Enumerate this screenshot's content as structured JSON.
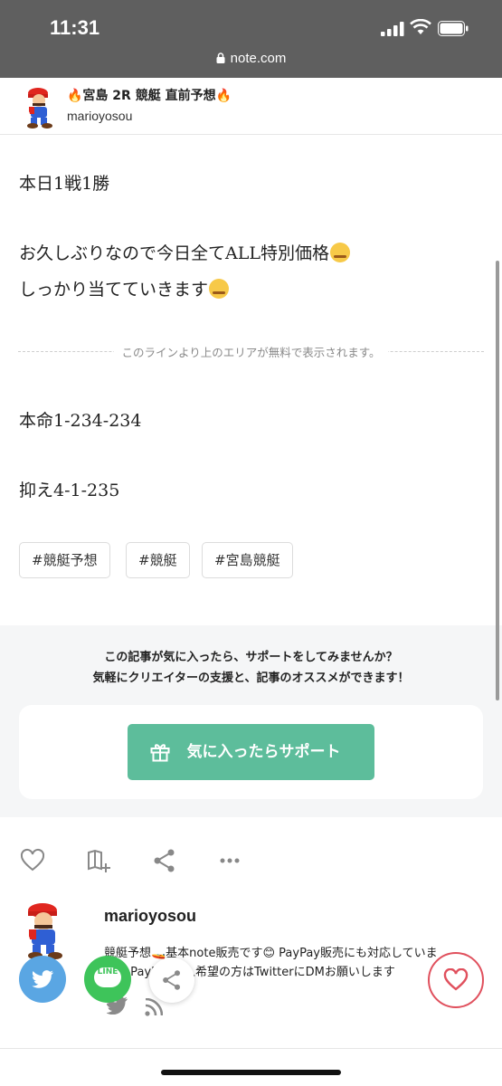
{
  "status_bar": {
    "time": "11:31",
    "url": "note.com"
  },
  "header": {
    "title": "🔥宮島 2R 競艇 直前予想🔥",
    "author": "marioyosou"
  },
  "article": {
    "line1": "本日1戦1勝",
    "line2": "お久しぶりなので今日全てALL特別価格",
    "line3": "しっかり当てていきます",
    "paywall_notice": "このラインより上のエリアが無料で表示されます。",
    "line4": "本命1-234-234",
    "line5": "抑え4-1-235"
  },
  "tags": [
    "#競艇予想",
    "#競艇",
    "#宮島競艇"
  ],
  "support": {
    "message1": "この記事が気に入ったら、サポートをしてみませんか？",
    "message2": "気軽にクリエイターの支援と、記事のオススメができます！",
    "button_label": "気に入ったらサポート"
  },
  "author_section": {
    "name": "marioyosou",
    "bio_line1": "競艇予想🚤基本note販売です😊 PayPay販売にも対応していま",
    "bio_line2": "す👍PayPay購入希望の方はTwitterにDMお願いします"
  },
  "share": {
    "line_label": "LINE"
  },
  "colors": {
    "support_green": "#5dbd9b",
    "twitter_blue": "#5aa6e3",
    "line_green": "#3ec45a",
    "like_red": "#e0505d"
  },
  "icons": [
    "lock-icon",
    "like-icon",
    "magazine-add-icon",
    "share-icon",
    "more-icon",
    "gift-icon",
    "twitter-icon",
    "rss-icon",
    "heart-icon"
  ]
}
